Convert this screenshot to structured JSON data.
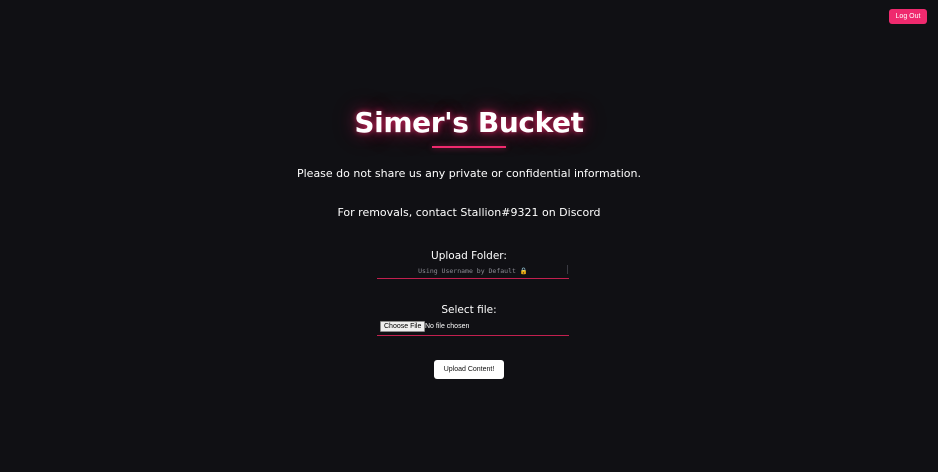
{
  "header": {
    "logout_label": "Log Out"
  },
  "main": {
    "title": "Simer's Bucket",
    "notice_private": "Please do not share us any private or confidential information.",
    "notice_removals": "For removals, contact Stallion#9321 on Discord"
  },
  "upload_folder": {
    "label": "Upload Folder:",
    "placeholder": "Using Username by Default 🔒",
    "value": ""
  },
  "file_select": {
    "label": "Select file:",
    "choose_button_label": "Choose File",
    "status_text": "No file chosen"
  },
  "submit": {
    "label": "Upload Content!"
  },
  "colors": {
    "background": "#101014",
    "accent": "#ef2a6e",
    "text": "#ffffff"
  }
}
